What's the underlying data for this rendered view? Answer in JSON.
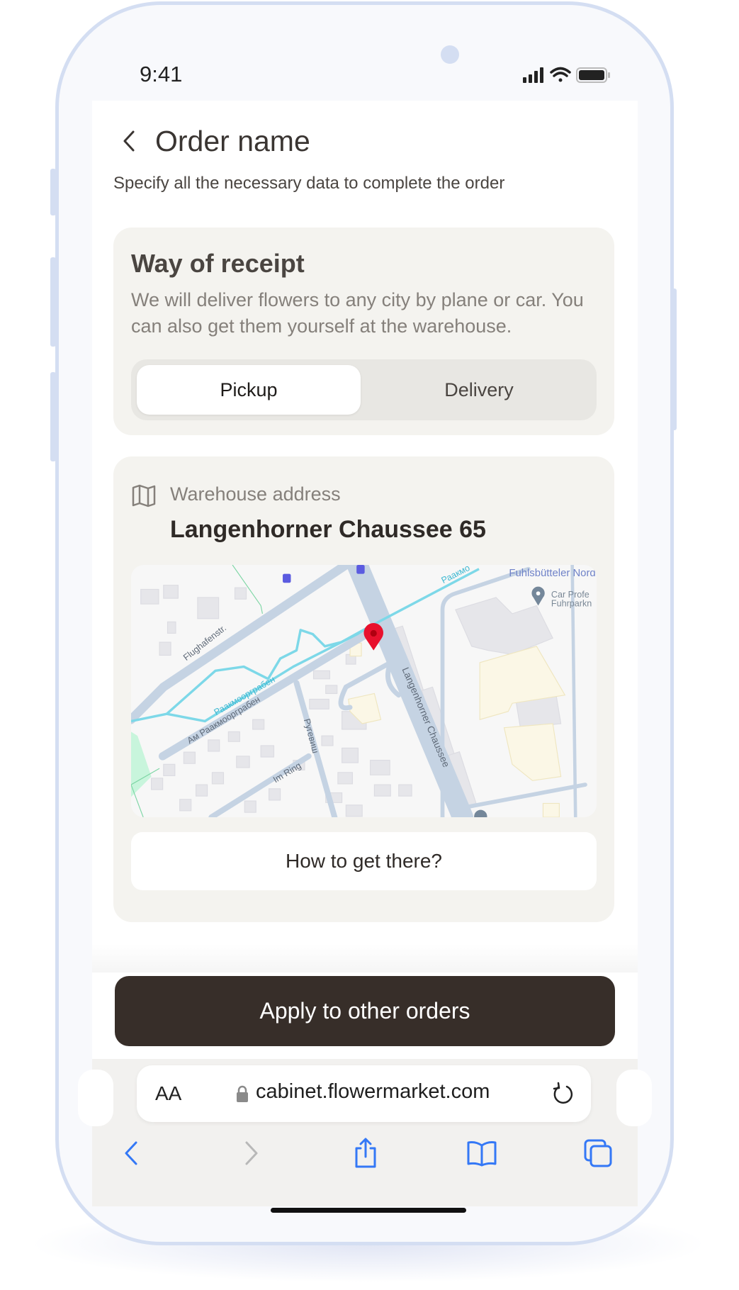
{
  "status_bar": {
    "time": "9:41",
    "icons": [
      "signal-icon",
      "wifi-icon",
      "battery-icon"
    ]
  },
  "header": {
    "title": "Order name",
    "subtitle": "Specify all the necessary data to complete the order",
    "back_icon": "chevron-left-icon"
  },
  "receipt": {
    "title": "Way of receipt",
    "description": "We will deliver flowers to any city by plane or car. You can also get them yourself at the warehouse.",
    "options": [
      {
        "label": "Pickup",
        "selected": true
      },
      {
        "label": "Delivery",
        "selected": false
      }
    ]
  },
  "warehouse": {
    "label": "Warehouse address",
    "address": "Langenhorner Chaussee 65",
    "map_labels": {
      "street_main": "Langenhorner Chaussee",
      "street_1": "Flughafenstr.",
      "street_2": "Ам Раакмоорграбен",
      "street_3": "Ругевиш",
      "street_4": "Im Ring",
      "river": "Раакмоорграбен",
      "river_2": "Раакмо",
      "poi_1": "Car Profe",
      "poi_2": "Fuhrparkn",
      "top_label": "Fuhlsbütteler Nord"
    },
    "directions_label": "How to get there?"
  },
  "apply_button": "Apply to other orders",
  "browser": {
    "text_size_label": "AA",
    "url": "cabinet.flowermarket.com",
    "toolbar_icons": [
      "back-icon",
      "forward-icon",
      "share-icon",
      "bookmarks-icon",
      "tabs-icon"
    ]
  },
  "colors": {
    "primary_button": "#372e29",
    "card": "#f4f3ef",
    "frame": "#d4def2",
    "pin": "#e8112d",
    "water": "#7dd8e8",
    "toolbar_icon": "#3478f6"
  }
}
